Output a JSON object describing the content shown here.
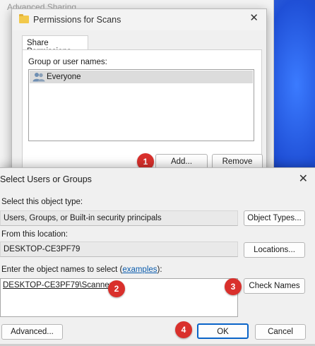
{
  "background_window": {
    "title": "Advanced Sharing"
  },
  "permissions_dialog": {
    "title": "Permissions for Scans",
    "tab": "Share Permissions",
    "group_label": "Group or user names:",
    "groups": [
      "Everyone"
    ],
    "add_button": "Add...",
    "remove_button": "Remove"
  },
  "select_dialog": {
    "title": "Select Users or Groups",
    "object_type_label": "Select this object type:",
    "object_type_value": "Users, Groups, or Built-in security principals",
    "object_types_button": "Object Types...",
    "location_label": "From this location:",
    "location_value": "DESKTOP-CE3PF79",
    "locations_button": "Locations...",
    "enter_names_prefix": "Enter the object names to select (",
    "examples_link": "examples",
    "enter_names_suffix": "):",
    "names_value": "DESKTOP-CE3PF79\\Scanner",
    "check_names_button": "Check Names",
    "advanced_button": "Advanced...",
    "ok_button": "OK",
    "cancel_button": "Cancel"
  },
  "step_badges": [
    "1",
    "2",
    "3",
    "4"
  ],
  "icons": {
    "close": "close-icon",
    "folder": "folder-icon",
    "users": "users-icon"
  },
  "colors": {
    "badge": "#d9302c",
    "ok_border": "#0a64c8",
    "link": "#0b5cad"
  }
}
